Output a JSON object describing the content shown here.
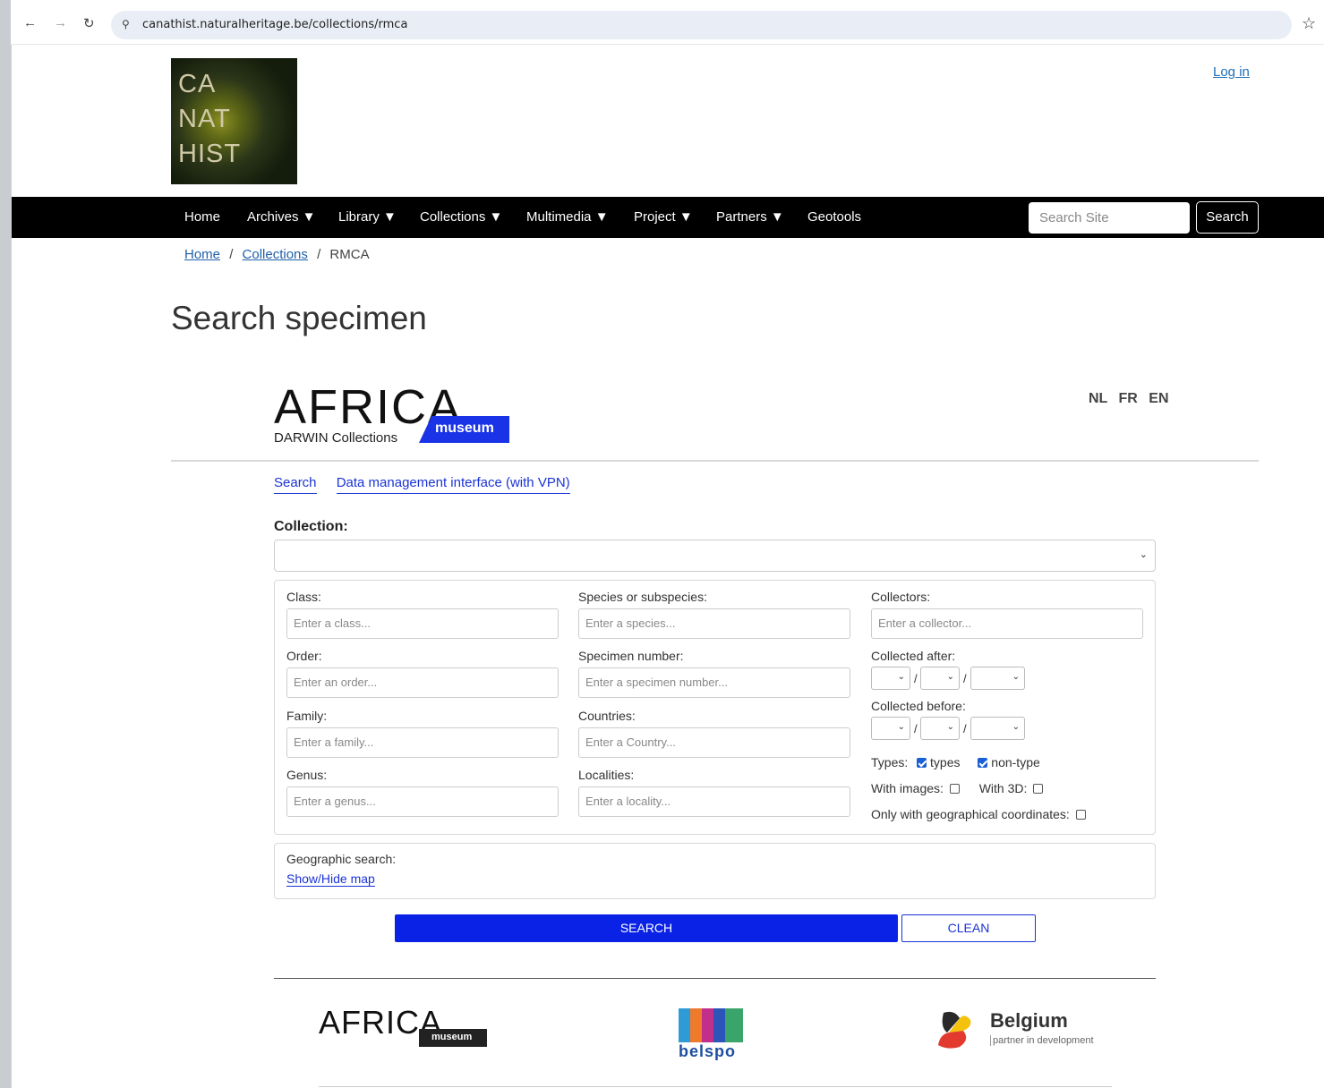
{
  "browser": {
    "url": "canathist.naturalheritage.be/collections/rmca"
  },
  "site": {
    "logo_lines": [
      "CA",
      "NAT",
      "HIST"
    ],
    "login": "Log in",
    "menu": [
      {
        "label": "Home"
      },
      {
        "label": "Archives ▼"
      },
      {
        "label": "Library ▼"
      },
      {
        "label": "Collections ▼"
      },
      {
        "label": "Multimedia ▼"
      },
      {
        "label": "Project ▼"
      },
      {
        "label": "Partners ▼"
      },
      {
        "label": "Geotools"
      }
    ],
    "search_placeholder": "Search Site",
    "search_button": "Search"
  },
  "breadcrumb": {
    "home": "Home",
    "sep1": "/",
    "collections": "Collections",
    "sep2": "/",
    "current": "RMCA"
  },
  "page_title": "Search specimen",
  "darwin": {
    "logo_text": "AFRICA",
    "logo_badge": "museum",
    "logo_sub": "DARWIN Collections",
    "languages": [
      "NL",
      "FR",
      "EN"
    ],
    "tabs": [
      "Search",
      "Data management interface (with VPN)"
    ],
    "collection_label": "Collection:",
    "collection_value": ""
  },
  "form": {
    "class_label": "Class:",
    "class_placeholder": "Enter a class...",
    "order_label": "Order:",
    "order_placeholder": "Enter an order...",
    "family_label": "Family:",
    "family_placeholder": "Enter a family...",
    "genus_label": "Genus:",
    "genus_placeholder": "Enter a genus...",
    "species_label": "Species or subspecies:",
    "species_placeholder": "Enter a species...",
    "specimen_label": "Specimen number:",
    "specimen_placeholder": "Enter a specimen number...",
    "countries_label": "Countries:",
    "countries_placeholder": "Enter a Country...",
    "localities_label": "Localities:",
    "localities_placeholder": "Enter a locality...",
    "collectors_label": "Collectors:",
    "collectors_placeholder": "Enter a collector...",
    "collected_after_label": "Collected after:",
    "collected_before_label": "Collected before:",
    "date_separator": "/",
    "types_label": "Types:",
    "types_option": "types",
    "types_checked": true,
    "nontype_option": "non-type",
    "nontype_checked": true,
    "with_images_label": "With images:",
    "with_images_checked": false,
    "with_3d_label": "With 3D:",
    "with_3d_checked": false,
    "geo_coords_label": "Only with geographical coordinates:",
    "geo_coords_checked": false,
    "geographic_label": "Geographic search:",
    "show_map": "Show/Hide map",
    "search_button": "SEARCH",
    "clean_button": "CLEAN"
  },
  "footer": {
    "africa_text": "AFRICA",
    "africa_badge": "museum",
    "belspo": "belspo",
    "belgium_name": "Belgium",
    "belgium_sub": "partner in development"
  },
  "colors": {
    "primary_blue": "#0a22e6",
    "link_blue": "#1a33d6",
    "menubar": "#000000"
  }
}
